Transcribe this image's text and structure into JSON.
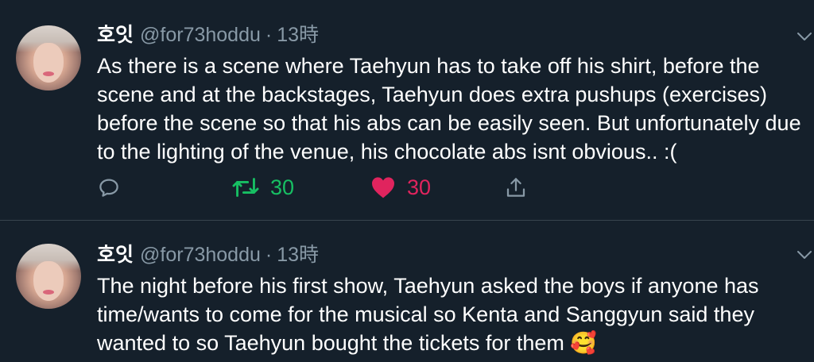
{
  "tweets": [
    {
      "display_name": "호잇",
      "handle": "@for73hoddu",
      "separator": "·",
      "time": "13時",
      "text": "As there is a scene where Taehyun has to take off his shirt, before the\nscene and at the backstages, Taehyun does extra pushups (exercises)\nbefore the scene so that his abs can be easily seen. But unfortunately due\nto the lighting of the venue, his chocolate abs isnt obvious.. :(",
      "retweet_count": "30",
      "like_count": "30",
      "liked": true,
      "retweeted": true
    },
    {
      "display_name": "호잇",
      "handle": "@for73hoddu",
      "separator": "·",
      "time": "13時",
      "text": "The night before his first show, Taehyun asked the boys if anyone has\ntime/wants to come for the musical so Kenta and Sanggyun said they\nwanted to so Taehyun bought the tickets for them 🥰"
    }
  ],
  "colors": {
    "background": "#15202b",
    "divider": "#38444d",
    "secondary_text": "#8899a6",
    "retweet_green": "#17bf63",
    "like_pink": "#e0245e"
  },
  "icons": [
    "reply-icon",
    "retweet-icon",
    "heart-icon",
    "share-icon",
    "chevron-down-icon",
    "smiling-face-with-hearts-emoji"
  ]
}
